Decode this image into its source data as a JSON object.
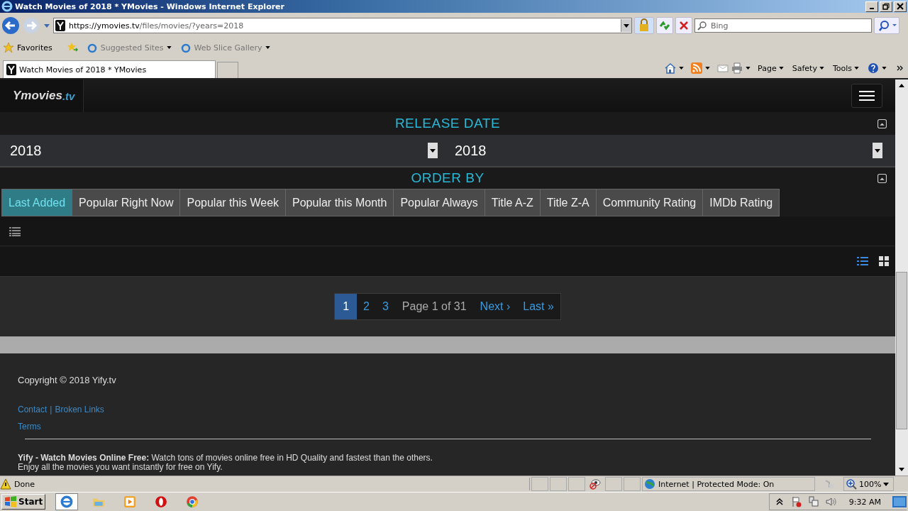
{
  "window": {
    "title": "Watch Movies of 2018 * YMovies - Windows Internet Explorer"
  },
  "address_bar": {
    "url_host": "https://ymovies.tv",
    "url_path": "/files/movies/?years=2018"
  },
  "search": {
    "placeholder": "Bing"
  },
  "favorites_bar": {
    "favorites": "Favorites",
    "links": [
      "Suggested Sites",
      "Web Slice Gallery"
    ]
  },
  "tabs": [
    {
      "label": "Watch Movies of 2018 * YMovies",
      "selected": true
    }
  ],
  "command_bar": [
    "Page",
    "Safety",
    "Tools"
  ],
  "page": {
    "logo": {
      "name": "Ymovies",
      "suffix": ".tv"
    },
    "release_date": {
      "title": "RELEASE DATE",
      "from": "2018",
      "to": "2018"
    },
    "order_by": {
      "title": "ORDER BY",
      "options": [
        {
          "label": "Last Added",
          "selected": true
        },
        {
          "label": "Popular Right Now",
          "selected": false
        },
        {
          "label": "Popular this Week",
          "selected": false
        },
        {
          "label": "Popular this Month",
          "selected": false
        },
        {
          "label": "Popular Always",
          "selected": false
        },
        {
          "label": "Title A-Z",
          "selected": false
        },
        {
          "label": "Title Z-A",
          "selected": false
        },
        {
          "label": "Community Rating",
          "selected": false
        },
        {
          "label": "IMDb Rating",
          "selected": false
        }
      ]
    },
    "view_modes": [
      {
        "kind": "list",
        "selected": true
      },
      {
        "kind": "grid",
        "selected": false
      }
    ],
    "pagination": {
      "pages": [
        {
          "label": "1",
          "selected": true
        },
        {
          "label": "2",
          "selected": false
        },
        {
          "label": "3",
          "selected": false
        }
      ],
      "info": "Page 1 of 31",
      "next": "Next ›",
      "last": "Last »"
    },
    "footer": {
      "copyright": "Copyright © 2018 Yify.tv",
      "links": [
        "Contact",
        "Broken Links"
      ],
      "separator": "|",
      "terms": "Terms",
      "description": [
        "**Yify - Watch Movies Online Free:** Watch tons of movies online free in HD Quality and fastest than the others.",
        "Enjoy all the movies you want instantly for free on Yify."
      ]
    }
  },
  "status_bar": {
    "text": "Done",
    "zone": "Internet | Protected Mode: On",
    "zoom": "100%"
  },
  "taskbar": {
    "start": "Start",
    "clock": "9:32 AM"
  }
}
